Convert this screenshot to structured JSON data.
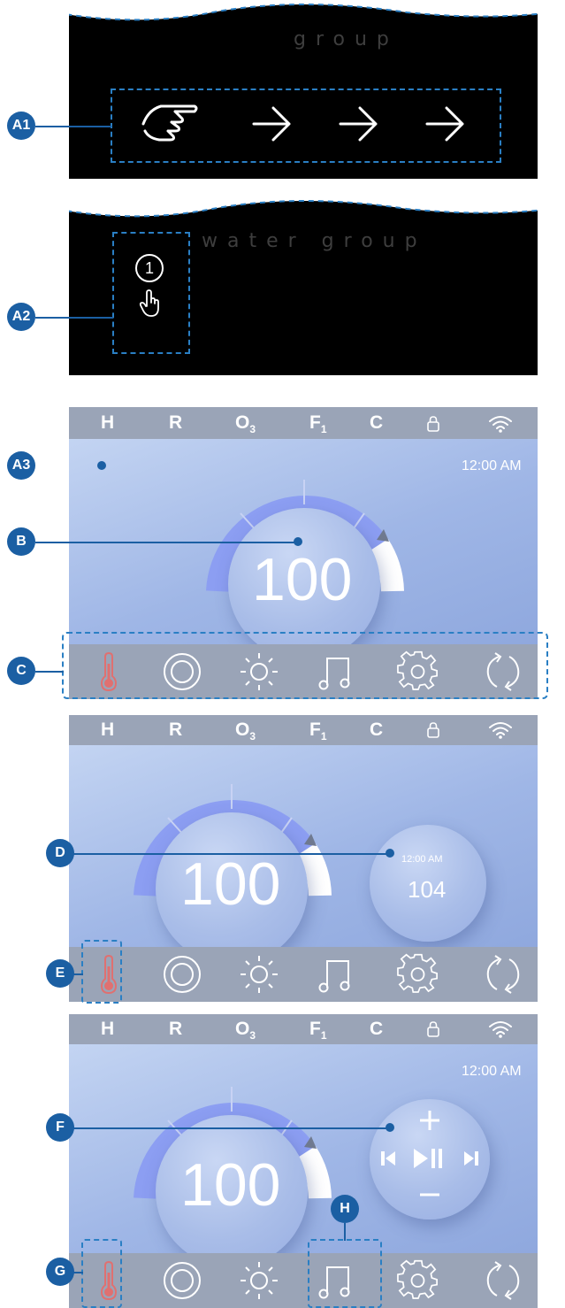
{
  "panels": {
    "a1": {
      "brand": "group",
      "callout": "A1"
    },
    "a2": {
      "brand": "water group",
      "step": "1",
      "callout": "A2"
    },
    "a3": {
      "callout_a3": "A3",
      "callout_b": "B",
      "callout_c": "C",
      "time": "12:00 AM",
      "temperature": "100"
    },
    "d": {
      "callout_d": "D",
      "callout_e": "E",
      "temperature": "100",
      "bubble_time": "12:00 AM",
      "bubble_value": "104"
    },
    "f": {
      "callout_f": "F",
      "callout_g": "G",
      "callout_h": "H",
      "time": "12:00 AM",
      "temperature": "100"
    }
  },
  "status_bar": {
    "h": "H",
    "r": "R",
    "o": "O",
    "o_sub": "3",
    "f": "F",
    "f_sub": "1",
    "c": "C"
  },
  "icons": [
    "lock-icon",
    "wifi-icon",
    "thermometer-icon",
    "jets-icon",
    "light-icon",
    "music-icon",
    "settings-icon",
    "cycle-icon",
    "plus-icon",
    "minus-icon",
    "previous-icon",
    "play-pause-icon",
    "next-icon",
    "pointing-hand-icon",
    "tap-icon",
    "arrow-right-icon"
  ],
  "colors": {
    "accent": "#1b5fa3",
    "dash": "#2a7fc4",
    "gauge": "#8c9ef2",
    "thermo": "#e07070",
    "bar": "#9aa4b7"
  }
}
